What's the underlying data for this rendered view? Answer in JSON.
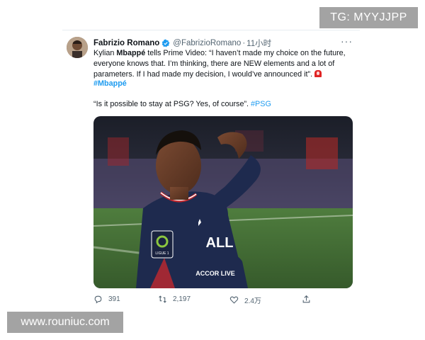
{
  "watermarks": {
    "top": "TG: MYYJJPP",
    "bottom": "www.rouniuc.com"
  },
  "tweet": {
    "author": {
      "name": "Fabrizio Romano",
      "handle": "@FabrizioRomano",
      "verified": true
    },
    "time": "11小时",
    "separator": "·",
    "more_label": "···",
    "body": {
      "part1": "Kylian ",
      "bold_name": "Mbappé",
      "part2": " tells Prime Video: “I haven’t made my choice on the future, everyone knows that. I’m thinking, there are NEW elements and a lot of parameters. If I had made my decision, I would’ve announced it”.",
      "hashtag": "#Mbappé",
      "quote": "“Is it possible to stay at PSG? Yes, of course”.",
      "quote_hashtag": "#PSG"
    },
    "media": {
      "jersey_sponsor": "ALL",
      "jersey_sponsor_sub": "ACCOR LIVE",
      "badge": "LIGUE 1"
    },
    "actions": {
      "replies": "391",
      "retweets": "2,197",
      "likes": "2.4万"
    },
    "colors": {
      "link": "#1d9bf0",
      "secondary": "#536471",
      "verified": "#1d9bf0"
    }
  }
}
